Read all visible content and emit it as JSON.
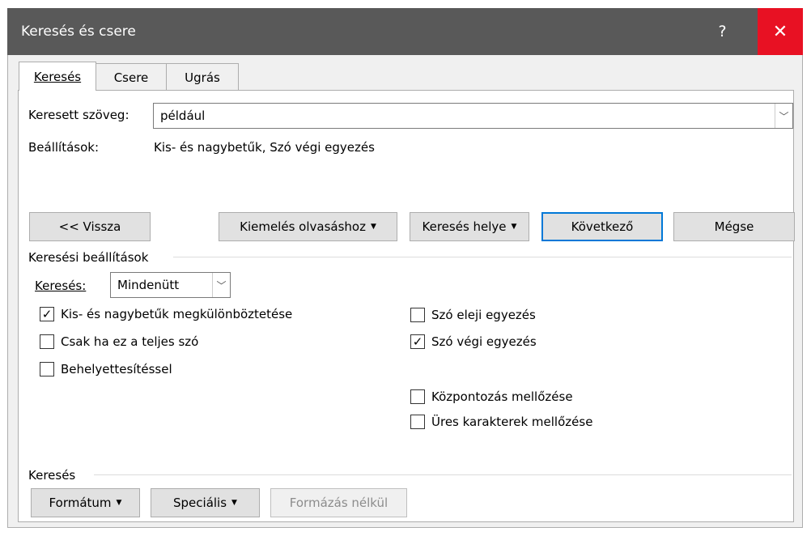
{
  "window": {
    "title": "Keresés és csere",
    "help": "?",
    "close": "✕"
  },
  "tabs": [
    {
      "label": "Keresés"
    },
    {
      "label": "Csere"
    },
    {
      "label": "Ugrás"
    }
  ],
  "find": {
    "label": "Keresett szöveg:",
    "value": "például",
    "options_label": "Beállítások:",
    "options_value": "Kis- és nagybetűk, Szó végi egyezés"
  },
  "buttons": {
    "less": "<< Vissza",
    "highlight": "Kiemelés olvasáshoz",
    "find_in": "Keresés helye",
    "find_next": "Következő",
    "cancel": "Mégse"
  },
  "search_options": {
    "group_label": "Keresési beállítások",
    "direction_label": "Keresés:",
    "direction_value": "Mindenütt",
    "checks": [
      {
        "label": "Kis- és nagybetűk megkülönböztetése",
        "checked": true
      },
      {
        "label": "Csak ha ez a teljes szó",
        "checked": false
      },
      {
        "label": "Behelyettesítéssel",
        "checked": false
      },
      {
        "label": "Szó eleji egyezés",
        "checked": false
      },
      {
        "label": "Szó végi egyezés",
        "checked": true
      },
      {
        "label": "Központozás mellőzése",
        "checked": false
      },
      {
        "label": "Üres karakterek mellőzése",
        "checked": false
      }
    ]
  },
  "find_section": {
    "group_label": "Keresés",
    "format": "Formátum",
    "special": "Speciális",
    "no_formatting": "Formázás nélkül"
  },
  "colors": {
    "titlebar": "#595959",
    "close": "#e81123",
    "accent": "#0078d7"
  }
}
